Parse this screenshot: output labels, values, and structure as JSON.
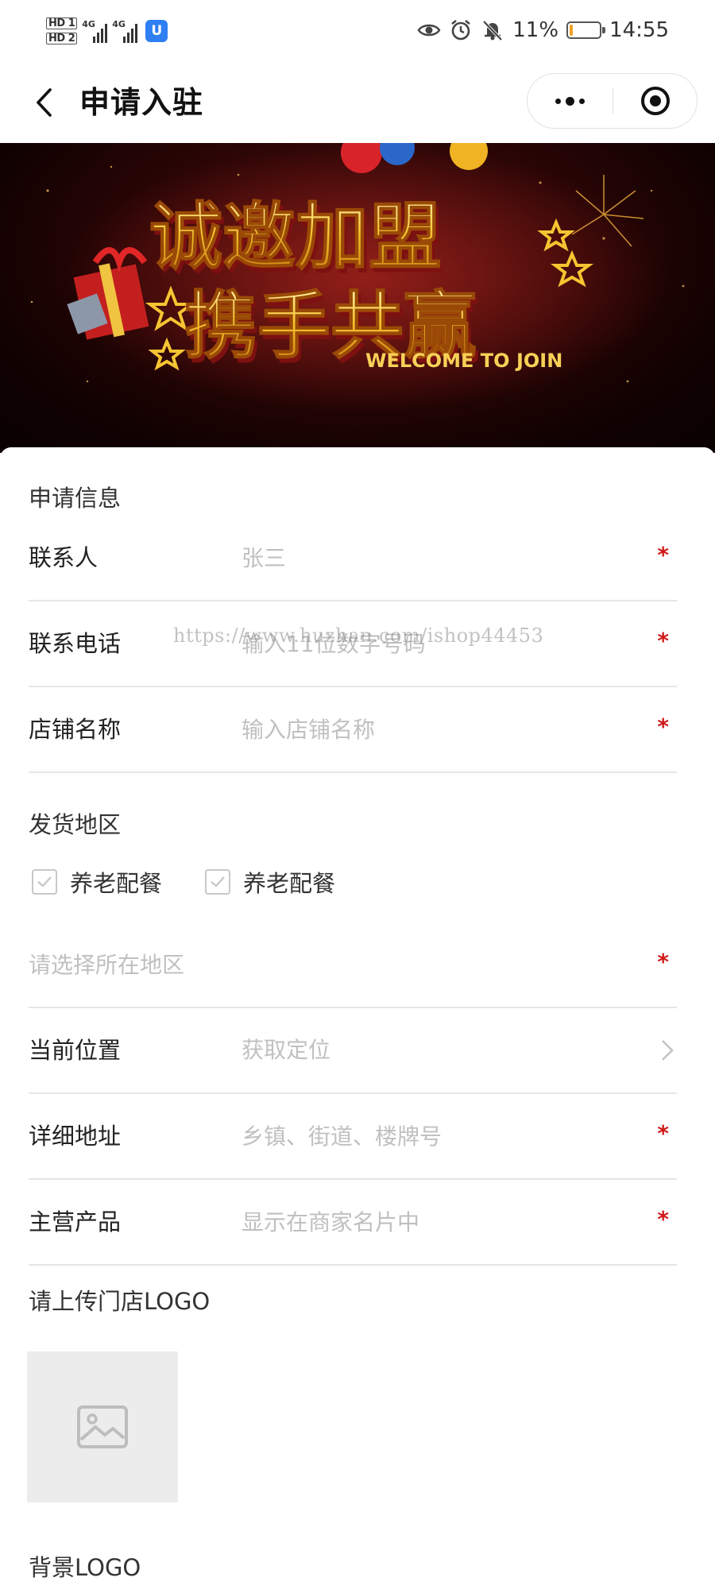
{
  "status_bar": {
    "hd1": "HD 1",
    "hd2": "HD 2",
    "net1": "4G",
    "net2": "4G",
    "app_badge": "U",
    "battery_text": "11%",
    "battery_level": 0.11,
    "battery_color": "#f0a022",
    "time": "14:55",
    "icons": [
      "eye-icon",
      "alarm-icon",
      "bell-off-icon",
      "battery-icon"
    ]
  },
  "nav": {
    "title": "申请入驻",
    "back_icon": "chevron-left-icon",
    "more_icon": "more-dots-icon",
    "close_icon": "target-circle-icon"
  },
  "banner": {
    "line1": "诚邀加盟",
    "line2": "携手共赢",
    "tagline": "WELCOME TO JOIN"
  },
  "form": {
    "section_info": "申请信息",
    "contact": {
      "label": "联系人",
      "placeholder": "张三",
      "required_mark": "*"
    },
    "phone": {
      "label": "联系电话",
      "placeholder": "输入11位数字号码",
      "required_mark": "*"
    },
    "shop_name": {
      "label": "店铺名称",
      "placeholder": "输入店铺名称",
      "required_mark": "*"
    },
    "watermark": "https://www.huzhan.com/ishop44453",
    "section_ship": "发货地区",
    "ship_options": [
      {
        "label": "养老配餐",
        "checked": true
      },
      {
        "label": "养老配餐",
        "checked": true
      }
    ],
    "region": {
      "placeholder": "请选择所在地区",
      "required_mark": "*"
    },
    "location": {
      "label": "当前位置",
      "value": "获取定位",
      "arrow_icon": "chevron-right-icon"
    },
    "address": {
      "label": "详细地址",
      "placeholder": "乡镇、街道、楼牌号",
      "required_mark": "*"
    },
    "products": {
      "label": "主营产品",
      "placeholder": "显示在商家名片中",
      "required_mark": "*"
    },
    "logo_title": "请上传门店LOGO",
    "upload_icon": "image-placeholder-icon",
    "bg_logo_title": "背景LOGO"
  },
  "colors": {
    "required": "#d01a1a",
    "placeholder": "#c0c0c0",
    "divider": "#e6e6e6"
  }
}
